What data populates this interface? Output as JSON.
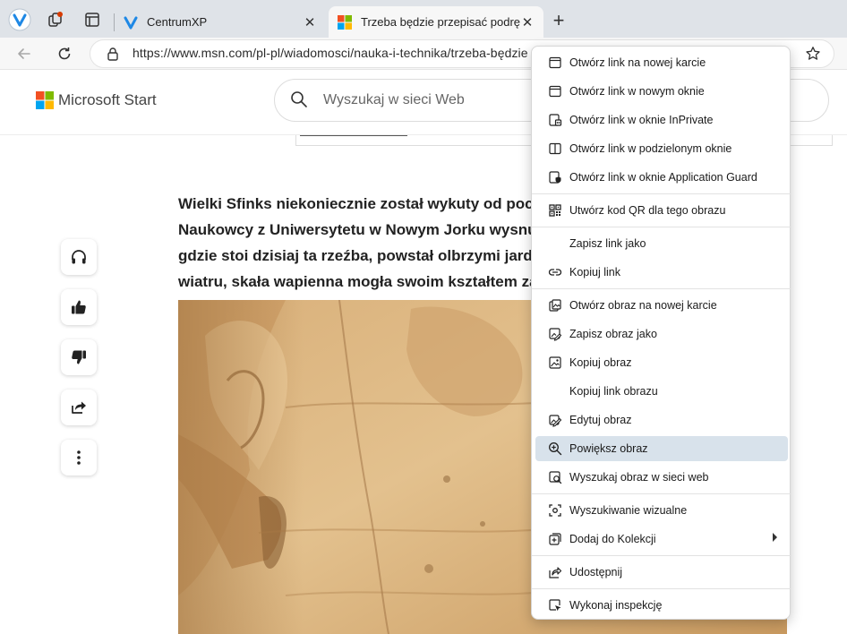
{
  "browser": {
    "tabs": [
      {
        "title": "CentrumXP",
        "active": false
      },
      {
        "title": "Trzeba będzie przepisać podręcz",
        "active": true
      }
    ],
    "close_glyph": "✕",
    "new_tab_glyph": "+",
    "url": "https://www.msn.com/pl-pl/wiadomosci/nauka-i-technika/trzeba-będzie"
  },
  "page": {
    "brand": "Microsoft Start",
    "search_placeholder": "Wyszukaj w sieci Web",
    "article_lines": [
      "Wielki Sfinks niekoniecznie został wykuty od pocz",
      "Naukowcy z Uniwersytetu w Nowym Jorku wysnu",
      "gdzie stoi dzisiaj ta rzeźba, powstał olbrzymi jard",
      "wiatru, skała wapienna mogła swoim kształtem za"
    ]
  },
  "context_menu": {
    "items": [
      {
        "label": "Otwórz link na nowej karcie",
        "icon": "new-tab-icon"
      },
      {
        "label": "Otwórz link w nowym oknie",
        "icon": "new-window-icon"
      },
      {
        "label": "Otwórz link w oknie InPrivate",
        "icon": "inprivate-window-icon"
      },
      {
        "label": "Otwórz link w podzielonym oknie",
        "icon": "split-window-icon"
      },
      {
        "label": "Otwórz link w oknie Application Guard",
        "icon": "application-guard-icon"
      },
      {
        "label": "Utwórz kod QR dla tego obrazu",
        "icon": "qr-code-icon"
      },
      {
        "label": "Zapisz link jako",
        "icon": ""
      },
      {
        "label": "Kopiuj link",
        "icon": "link-icon"
      },
      {
        "label": "Otwórz obraz na nowej karcie",
        "icon": "open-image-icon"
      },
      {
        "label": "Zapisz obraz jako",
        "icon": "save-image-icon"
      },
      {
        "label": "Kopiuj obraz",
        "icon": "copy-image-icon"
      },
      {
        "label": "Kopiuj link obrazu",
        "icon": ""
      },
      {
        "label": "Edytuj obraz",
        "icon": "edit-image-icon"
      },
      {
        "label": "Powiększ obraz",
        "icon": "zoom-in-icon",
        "highlighted": true
      },
      {
        "label": "Wyszukaj obraz w sieci web",
        "icon": "image-search-icon"
      },
      {
        "label": "Wyszukiwanie wizualne",
        "icon": "visual-search-icon"
      },
      {
        "label": "Dodaj do Kolekcji",
        "icon": "collections-icon",
        "submenu": true
      },
      {
        "label": "Udostępnij",
        "icon": "share-icon"
      },
      {
        "label": "Wykonaj inspekcję",
        "icon": "inspect-icon"
      }
    ]
  },
  "colors": {
    "tabstrip": "#dfe3e8",
    "highlight": "#d8e2eb",
    "ms_red": "#f25022",
    "ms_green": "#7fba00",
    "ms_blue": "#00a4ef",
    "ms_yellow": "#ffb900",
    "vivaldi_blue": "#1e88e5"
  }
}
